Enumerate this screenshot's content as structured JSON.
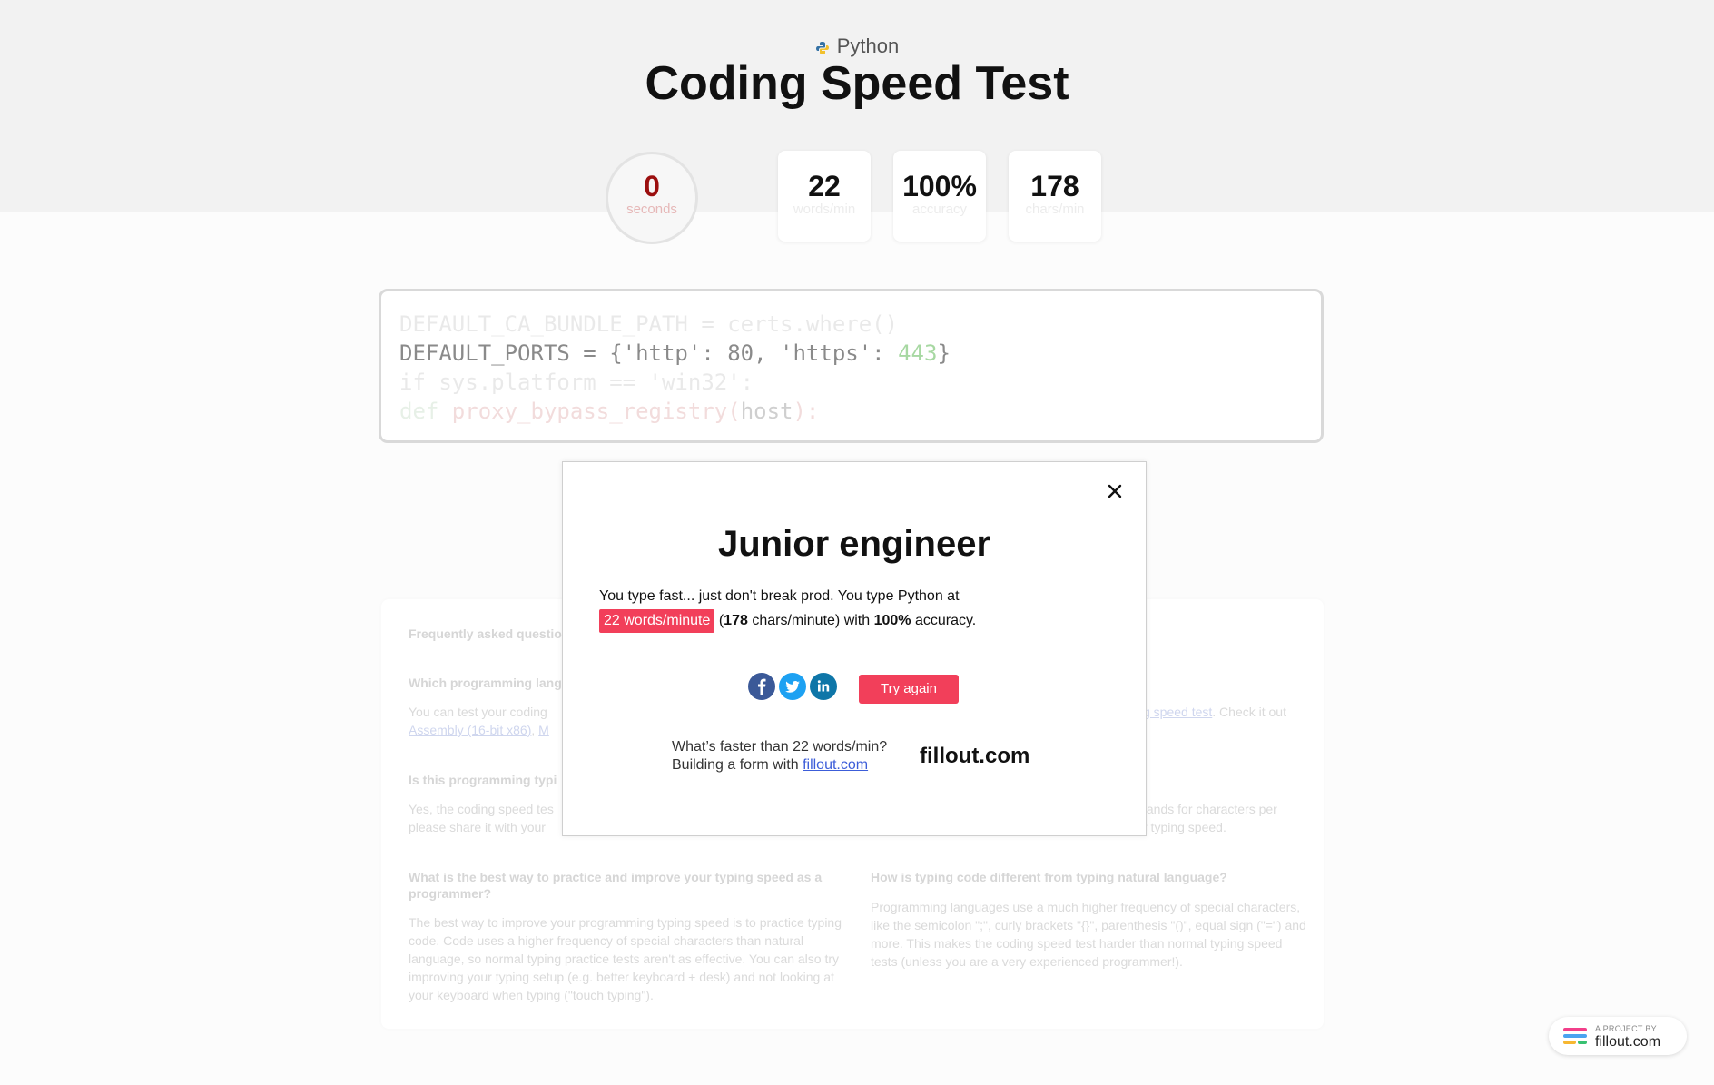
{
  "header": {
    "language": "Python",
    "title": "Coding Speed Test"
  },
  "stats": {
    "timer": {
      "value": "0",
      "unit": "seconds"
    },
    "wpm": {
      "value": "22",
      "unit": "words/min"
    },
    "accuracy": {
      "value": "100%",
      "unit": "accuracy"
    },
    "cpm": {
      "value": "178",
      "unit": "chars/min"
    }
  },
  "code": {
    "lines": [
      "DEFAULT_CA_BUNDLE_PATH = certs.where()",
      "DEFAULT_PORTS = {'http': 80, 'https': 443}",
      "if sys.platform == 'win32':",
      "def proxy_bypass_registry(host):"
    ],
    "line2_prefix": "DEFAULT_PORTS = {'http': 80, 'https': ",
    "line2_number": "443",
    "line2_suffix": "}",
    "line4_kw": "def ",
    "line4_fn": "proxy_bypass_registry",
    "line4_open": "(",
    "line4_cur": "host",
    "line4_close": "):"
  },
  "modal": {
    "title": "Junior engineer",
    "line1": "You type fast... just don't break prod. You type Python at",
    "wpm_badge": "22 words/minute",
    "paren_open": " (",
    "cpm_value": "178",
    "cpm_rest": " chars/minute) with ",
    "accuracy_value": "100%",
    "accuracy_rest": " accuracy.",
    "try_again": "Try again",
    "promo_line1": "What’s faster than 22 words/min?",
    "promo_line2_prefix": "Building a form with ",
    "promo_link": "fillout.com",
    "promo_logo": "fillout.com",
    "share": [
      "facebook-icon",
      "twitter-icon",
      "linkedin-icon"
    ]
  },
  "faq": {
    "heading": "Frequently asked questio",
    "q1": "Which programming lang",
    "a1_line1": "You can test your coding",
    "a1_link1": "Assembly (16-bit x86)",
    "a1_sep": ", ",
    "a1_link2": "M",
    "a1_right_link": "g speed test",
    "a1_right_rest": ". Check it out",
    "q2": "Is this programming typi",
    "a2_line1": "Yes, the coding speed tes",
    "a2_line2": "please share it with your",
    "a2_right_line1": "tands for characters per",
    "a2_right_line2": "r typing speed.",
    "q3": "What is the best way to practice and improve your typing speed as a programmer?",
    "a3": "The best way to improve your programming typing speed is to practice typing code. Code uses a higher frequency of special characters than natural language, so normal typing practice tests aren't as effective. You can also try improving your typing setup (e.g. better keyboard + desk) and not looking at your keyboard when typing (\"touch typing\").",
    "q4": "How is typing code different from typing natural language?",
    "a4": "Programming languages use a much higher frequency of special characters, like the semicolon \";\", curly brackets \"{}\", parenthesis \"()\", equal sign (\"=\") and more. This makes the coding speed test harder than normal typing speed tests (unless you are a very experienced programmer!)."
  },
  "badge": {
    "small": "A PROJECT BY",
    "brand": "fillout.com"
  },
  "colors": {
    "accent": "#f23f5a",
    "timer_number": "#9b0f0f",
    "link": "#3c5dd9"
  }
}
